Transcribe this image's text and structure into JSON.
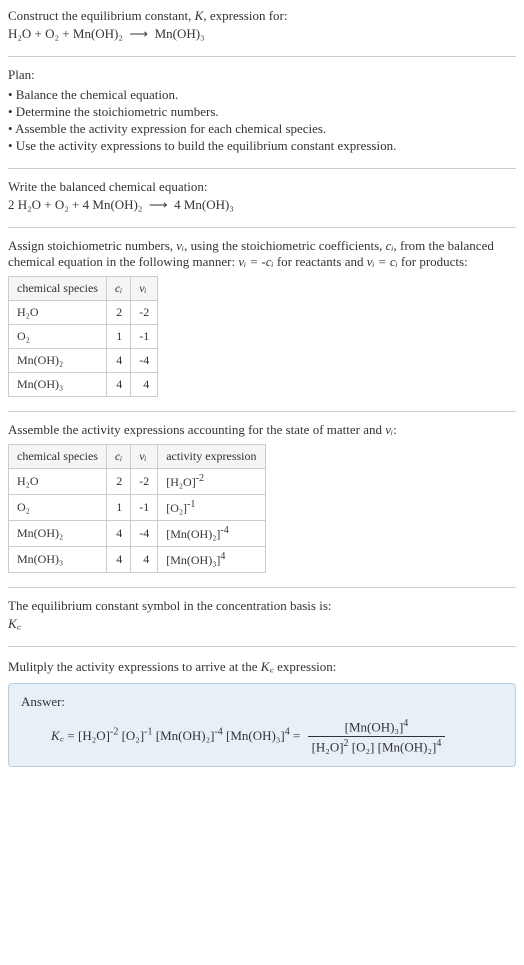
{
  "intro": {
    "line1": "Construct the equilibrium constant, ",
    "k": "K",
    "line1b": ", expression for:",
    "eq_l": "H₂O + O₂ + Mn(OH)₂",
    "arrow": "⟶",
    "eq_r": "Mn(OH)₃"
  },
  "plan": {
    "title": "Plan:",
    "items": [
      "• Balance the chemical equation.",
      "• Determine the stoichiometric numbers.",
      "• Assemble the activity expression for each chemical species.",
      "• Use the activity expressions to build the equilibrium constant expression."
    ]
  },
  "balanced": {
    "title": "Write the balanced chemical equation:",
    "eq_l": "2 H₂O + O₂ + 4 Mn(OH)₂",
    "arrow": "⟶",
    "eq_r": "4 Mn(OH)₃"
  },
  "stoich": {
    "intro1": "Assign stoichiometric numbers, ",
    "nu": "νᵢ",
    "intro2": ", using the stoichiometric coefficients, ",
    "ci": "cᵢ",
    "intro3": ", from the balanced chemical equation in the following manner: ",
    "rel1": "νᵢ = -cᵢ",
    "intro4": " for reactants and ",
    "rel2": "νᵢ = cᵢ",
    "intro5": " for products:",
    "headers": [
      "chemical species",
      "cᵢ",
      "νᵢ"
    ],
    "rows": [
      {
        "species": "H₂O",
        "c": "2",
        "v": "-2"
      },
      {
        "species": "O₂",
        "c": "1",
        "v": "-1"
      },
      {
        "species": "Mn(OH)₂",
        "c": "4",
        "v": "-4"
      },
      {
        "species": "Mn(OH)₃",
        "c": "4",
        "v": "4"
      }
    ]
  },
  "activity": {
    "intro1": "Assemble the activity expressions accounting for the state of matter and ",
    "nu": "νᵢ",
    "intro2": ":",
    "headers": [
      "chemical species",
      "cᵢ",
      "νᵢ",
      "activity expression"
    ],
    "rows": [
      {
        "species": "H₂O",
        "c": "2",
        "v": "-2",
        "expr_base": "[H₂O]",
        "expr_exp": "-2"
      },
      {
        "species": "O₂",
        "c": "1",
        "v": "-1",
        "expr_base": "[O₂]",
        "expr_exp": "-1"
      },
      {
        "species": "Mn(OH)₂",
        "c": "4",
        "v": "-4",
        "expr_base": "[Mn(OH)₂]",
        "expr_exp": "-4"
      },
      {
        "species": "Mn(OH)₃",
        "c": "4",
        "v": "4",
        "expr_base": "[Mn(OH)₃]",
        "expr_exp": "4"
      }
    ]
  },
  "basis": {
    "line1": "The equilibrium constant symbol in the concentration basis is:",
    "symbol": "K꜀"
  },
  "multiply": {
    "line1a": "Mulitply the activity expressions to arrive at the ",
    "kc": "K꜀",
    "line1b": " expression:"
  },
  "answer": {
    "label": "Answer:",
    "kc": "K꜀",
    "eq": " = ",
    "t1b": "[H₂O]",
    "t1e": "-2",
    "t2b": "[O₂]",
    "t2e": "-1",
    "t3b": "[Mn(OH)₂]",
    "t3e": "-4",
    "t4b": "[Mn(OH)₃]",
    "t4e": "4",
    "eq2": " = ",
    "num_b": "[Mn(OH)₃]",
    "num_e": "4",
    "den1b": "[H₂O]",
    "den1e": "2",
    "den2b": "[O₂]",
    "den3b": "[Mn(OH)₂]",
    "den3e": "4"
  }
}
